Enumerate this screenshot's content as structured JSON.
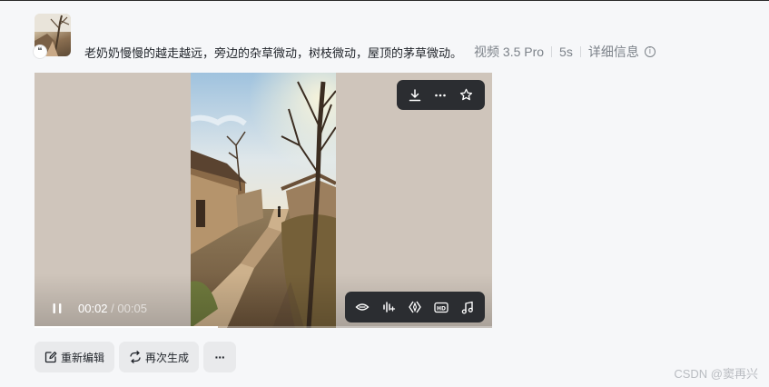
{
  "prompt": {
    "text": "老奶奶慢慢的越走越远，旁边的杂草微动，树枝微动，屋顶的茅草微动。",
    "model": "视频 3.5 Pro",
    "duration": "5s",
    "details_label": "详细信息"
  },
  "badge": {
    "glyph": "❝"
  },
  "player": {
    "current_time": "00:02",
    "separator": " / ",
    "total_time": "00:05",
    "progress_fraction": 0.4
  },
  "top_toolbar": {
    "items": [
      "download-icon",
      "more-horizontal-icon",
      "star-icon"
    ]
  },
  "bottom_toolbar": {
    "items": [
      "lip-sync-icon",
      "audio-wave-icon",
      "frame-interpolation-icon",
      "hd-upscale-icon",
      "music-note-icon"
    ],
    "hd_text": "HD"
  },
  "actions": {
    "reedit_label": "重新编辑",
    "regenerate_label": "再次生成",
    "more_label": "···"
  },
  "watermark": "CSDN @窦再兴"
}
